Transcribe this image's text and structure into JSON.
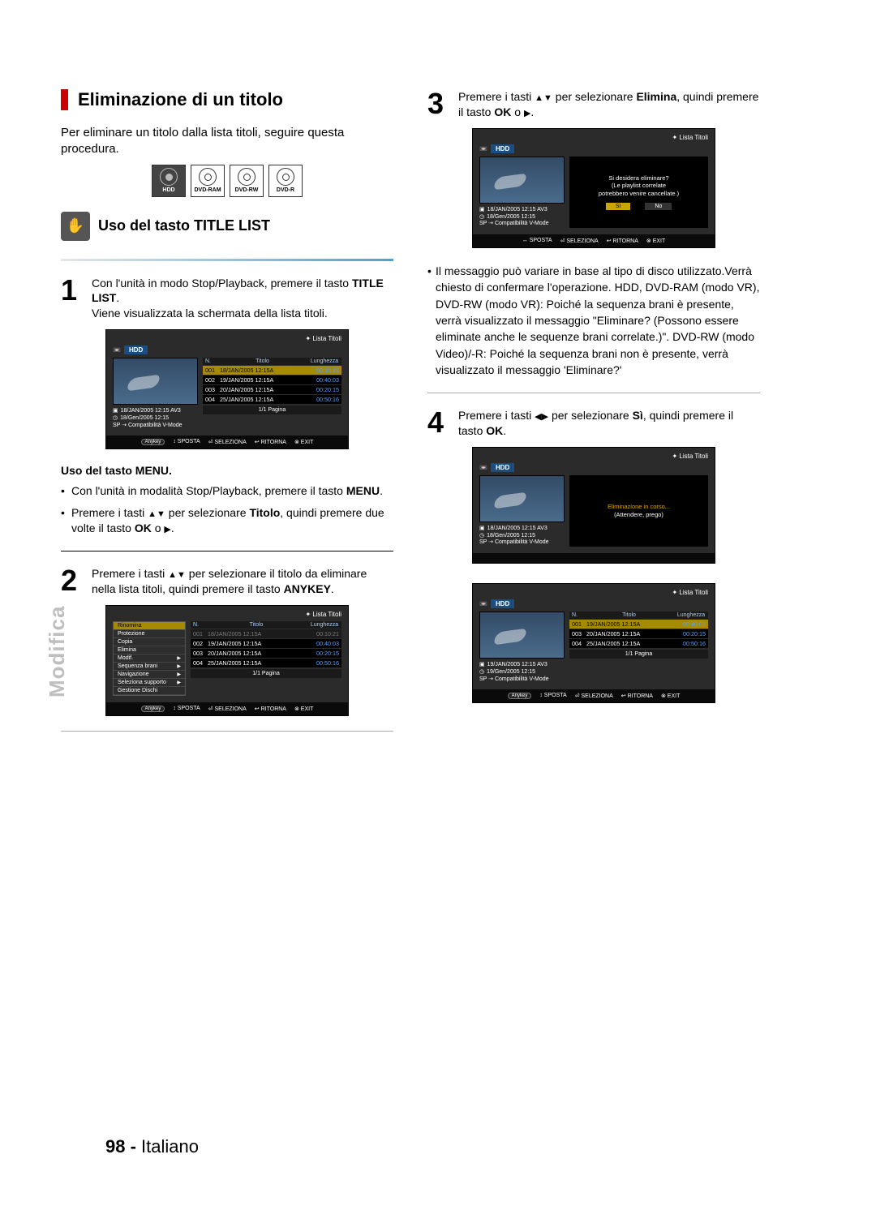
{
  "side_tab": "Modifica",
  "footer": {
    "page": "98 -",
    "lang": "Italiano"
  },
  "left": {
    "section_title": "Eliminazione di un titolo",
    "intro": "Per eliminare un titolo dalla lista titoli, seguire questa procedura.",
    "media": [
      "HDD",
      "DVD-RAM",
      "DVD-RW",
      "DVD-R"
    ],
    "sub_title": "Uso del tasto TITLE LIST",
    "step1_a": "Con l'unità in modo Stop/Playback, premere il tasto ",
    "step1_b": "TITLE LIST",
    "step1_c": "Viene visualizzata la schermata della lista titoli.",
    "menu_head": "Uso del tasto MENU.",
    "menu_b1_a": "Con l'unità in modalità Stop/Playback, premere il tasto ",
    "menu_b1_b": "MENU",
    "menu_b2_a": "Premere i tasti ",
    "menu_b2_b": " per selezionare ",
    "menu_b2_c": "Titolo",
    "menu_b2_d": ", quindi premere due volte il tasto ",
    "menu_b2_e": "OK",
    "menu_b2_f": " o ",
    "step2_a": "Premere i tasti ",
    "step2_b": " per selezionare il titolo da eliminare nella lista titoli, quindi premere il tasto ",
    "step2_c": "ANYKEY"
  },
  "right": {
    "step3_a": "Premere i tasti ",
    "step3_b": " per selezionare ",
    "step3_c": "Elimina",
    "step3_d": ", quindi premere il tasto ",
    "step3_e": "OK",
    "step3_f": " o ",
    "note": "Il messaggio può variare in base al tipo di disco utilizzato.Verrà chiesto di confermare l'operazione. HDD, DVD-RAM (modo VR), DVD-RW (modo VR): Poiché la sequenza brani è presente, verrà visualizzato il messaggio \"Eliminare? (Possono essere eliminate anche le sequenze brani correlate.)\". DVD-RW (modo Video)/-R: Poiché la sequenza brani non è presente, verrà visualizzato il messaggio 'Eliminare?'",
    "step4_a": "Premere i tasti ",
    "step4_b": " per selezionare ",
    "step4_c": "Sì",
    "step4_d": ", quindi premere il tasto ",
    "step4_e": "OK"
  },
  "tv": {
    "title": "Lista Titoli",
    "hdd": "HDD",
    "nh": "N.",
    "th": "Titolo",
    "lh": "Lunghezza",
    "rows": [
      {
        "n": "001",
        "t": "18/JAN/2005 12:15A",
        "d": "00:10:21"
      },
      {
        "n": "002",
        "t": "19/JAN/2005 12:15A",
        "d": "00:40:03"
      },
      {
        "n": "003",
        "t": "20/JAN/2005 12:15A",
        "d": "00:20:15"
      },
      {
        "n": "004",
        "t": "25/JAN/2005 12:15A",
        "d": "00:50:16"
      }
    ],
    "rows_after": [
      {
        "n": "001",
        "t": "19/JAN/2005 12:15A",
        "d": "00:40:03"
      },
      {
        "n": "003",
        "t": "20/JAN/2005 12:15A",
        "d": "00:20:15"
      },
      {
        "n": "004",
        "t": "25/JAN/2005 12:15A",
        "d": "00:50:16"
      }
    ],
    "meta1": "18/JAN/2005 12:15 AV3",
    "meta1b": "19/JAN/2005 12:15 AV3",
    "meta2": "18/Gen/2005 12:15",
    "meta2b": "19/Gen/2005 12:15",
    "meta3": "SP ⇢ Compatibilità V-Mode",
    "page": "1/1 Pagina",
    "btm": {
      "sposta": "SPOSTA",
      "sel": "SELEZIONA",
      "rit": "RITORNA",
      "exit": "EXIT",
      "anykey": "Anykey"
    },
    "ctx": [
      "Rinomina",
      "Protezione",
      "Copia",
      "Elimina",
      "Modif.",
      "Sequenza brani",
      "Navigazione",
      "Seleziona supporto",
      "Gestione Dischi"
    ],
    "dlg1_l1": "Si desidera eliminare?",
    "dlg1_l2": "(Le playlist correlate",
    "dlg1_l3": "potrebbero venire cancellate.)",
    "dlg_si": "Sì",
    "dlg_no": "No",
    "dlg2_l1": "Eliminazione in corso...",
    "dlg2_l2": "(Attendere, prego)"
  }
}
